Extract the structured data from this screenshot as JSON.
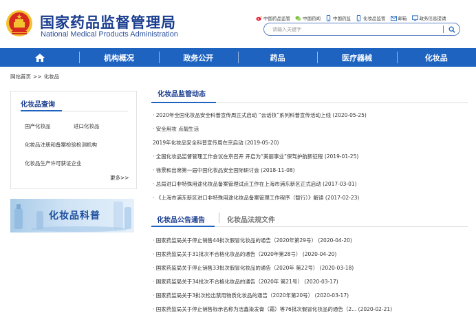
{
  "header": {
    "title_cn": "国家药品监督管理局",
    "title_en": "National Medical Products Administration",
    "emblem_icon": "national-emblem-icon",
    "top_links": [
      {
        "label": "中国药品监管",
        "icon": "weibo-icon"
      },
      {
        "label": "中国药闻",
        "icon": "wechat-icon"
      },
      {
        "label": "中国药监",
        "icon": "mobile-icon"
      },
      {
        "label": "化妆品监管",
        "icon": "mobile-icon"
      },
      {
        "label": "邮箱",
        "icon": "mail-icon"
      },
      {
        "label": "政务信息提请",
        "icon": "monitor-icon"
      }
    ],
    "search": {
      "placeholder": "请输入关键字",
      "icon": "search-icon"
    }
  },
  "nav": {
    "items": [
      "机构概况",
      "政务公开",
      "药品",
      "医疗器械",
      "化妆品"
    ],
    "home_icon": "home-icon"
  },
  "breadcrumb": {
    "home": "网站首页",
    "separator": ">>",
    "current": "化妆品"
  },
  "sidebar": {
    "title": "化妆品查询",
    "links": [
      "国产化妆品",
      "进口化妆品",
      "化妆品注册和备案检验检测机构",
      "化妆品生产许可获证企业"
    ],
    "more": "更多>>",
    "banner_text": "化妆品科普"
  },
  "main": {
    "section_title": "化妆品监管动态",
    "news": [
      {
        "bullet": "·",
        "title": "2020年全国化妆品安全科普宣传周正式启动 “云话妆”系列科普宣传活动上线",
        "date": "(2020-05-25)"
      },
      {
        "bullet": "·",
        "title": "安全用妆 点靓生活",
        "date": ""
      },
      {
        "bullet": "",
        "title": "2019年化妆品安全科普宣传周在京启动",
        "date": "(2019-05-20)"
      },
      {
        "bullet": "·",
        "title": "全国化妆品监督管理工作会议在京召开 开启为“美丽事业”保驾护航新征程",
        "date": "(2019-01-25)"
      },
      {
        "bullet": "·",
        "title": "徐景和出席第一届中国化妆品安全国际研讨会",
        "date": "(2018-11-08)"
      },
      {
        "bullet": "·",
        "title": "总局进口非特殊用途化妆品备案管理试点工作在上海市浦东新区正式启动",
        "date": "(2017-03-01)"
      },
      {
        "bullet": "·",
        "title": "《上海市浦东新区进口非特殊用途化妆品备案管理工作程序（暂行）》解读",
        "date": "(2017-02-23)"
      }
    ],
    "tabs": {
      "active": "化妆品公告通告",
      "inactive": "化妆品法规文件"
    },
    "notices": [
      {
        "title": "国家药监局关于停止销售44批次假冒化妆品的通告（2020年第29号）",
        "date": "(2020-04-20)"
      },
      {
        "title": "国家药监局关于31批次不合格化妆品的通告（2020年第28号）",
        "date": "(2020-04-20)"
      },
      {
        "title": "国家药监局关于停止销售33批次假冒化妆品的通告（2020年 第22号）",
        "date": "(2020-03-18)"
      },
      {
        "title": "国家药监局关于34批次不合格化妆品的通告（2020年 第21号）",
        "date": "(2020-03-17)"
      },
      {
        "title": "国家药监局关于3批次检出禁用物质化妆品的通告（2020年第20号）",
        "date": "(2020-03-17)"
      },
      {
        "title": "国家药监局关于停止销售标示名称为洁鑫染发膏（霜）等76批次假冒化妆品的通告（2...",
        "date": "(2020-02-21)"
      }
    ]
  },
  "colors": {
    "brand_blue": "#1e63c0",
    "title_blue": "#1a3d8f",
    "emblem_red": "#d62a1e",
    "emblem_gold": "#f2c230"
  }
}
